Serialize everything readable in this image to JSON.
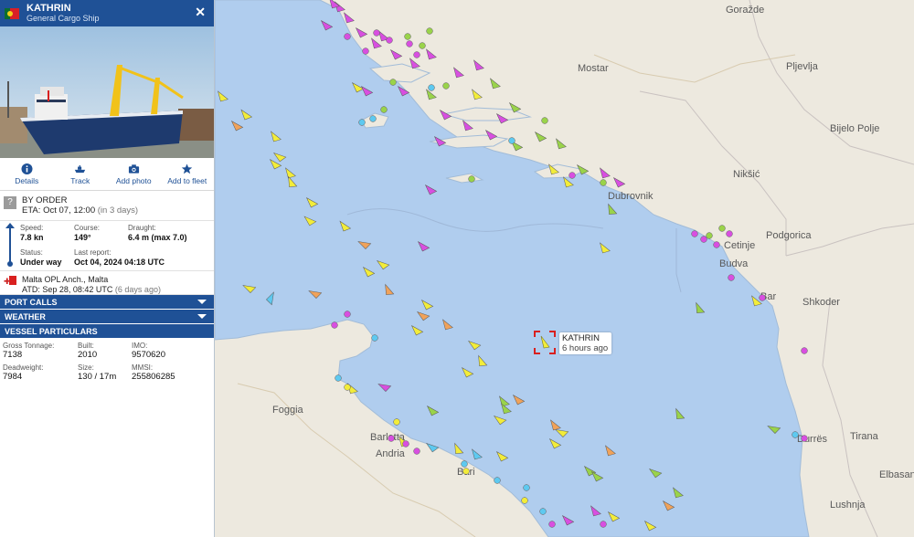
{
  "vessel": {
    "name": "KATHRIN",
    "type": "General Cargo Ship",
    "flag_colors": {
      "green": "#0a6d2f",
      "red": "#d91f26",
      "yellow": "#f4d019"
    }
  },
  "actions": [
    {
      "label": "Details",
      "icon": "info-icon"
    },
    {
      "label": "Track",
      "icon": "ship-icon"
    },
    {
      "label": "Add photo",
      "icon": "camera-icon"
    },
    {
      "label": "Add to fleet",
      "icon": "star-icon"
    }
  ],
  "destination": {
    "name": "BY ORDER",
    "eta_label": "ETA:",
    "eta": "Oct 07, 12:00",
    "eta_rel": "(in 3 days)"
  },
  "voyage": {
    "speed_label": "Speed:",
    "speed": "7.8 kn",
    "course_label": "Course:",
    "course": "149°",
    "draught_label": "Draught:",
    "draught": "6.4 m (max 7.0)",
    "status_label": "Status:",
    "status": "Under way",
    "last_report_label": "Last report:",
    "last_report": "Oct 04, 2024 04:18 UTC"
  },
  "departure": {
    "port": "Malta OPL Anch., Malta",
    "atd_label": "ATD:",
    "atd": "Sep 28, 08:42 UTC",
    "atd_rel": "(6 days ago)"
  },
  "sections": {
    "port_calls": "PORT CALLS",
    "weather": "WEATHER",
    "particulars": "VESSEL PARTICULARS"
  },
  "particulars": {
    "gross_tonnage_label": "Gross Tonnage:",
    "gross_tonnage": "7138",
    "built_label": "Built:",
    "built": "2010",
    "imo_label": "IMO:",
    "imo": "9570620",
    "deadweight_label": "Deadweight:",
    "deadweight": "7984",
    "size_label": "Size:",
    "size": "130 / 17m",
    "mmsi_label": "MMSI:",
    "mmsi": "255806285"
  },
  "map": {
    "target_name": "KATHRIN",
    "target_age": "6 hours ago",
    "cities": [
      {
        "name": "Goražde"
      },
      {
        "name": "Mostar"
      },
      {
        "name": "Pljevlja"
      },
      {
        "name": "Bijelo Polje"
      },
      {
        "name": "Nikšić"
      },
      {
        "name": "Dubrovnik"
      },
      {
        "name": "Cetinje"
      },
      {
        "name": "Podgorica"
      },
      {
        "name": "Budva"
      },
      {
        "name": "Bar"
      },
      {
        "name": "Shkoder"
      },
      {
        "name": "Foggia"
      },
      {
        "name": "Barletta"
      },
      {
        "name": "Andria"
      },
      {
        "name": "Bari"
      },
      {
        "name": "Durrës"
      },
      {
        "name": "Tirana"
      },
      {
        "name": "Elbasan"
      },
      {
        "name": "Lushnja"
      }
    ],
    "colors": {
      "sea": "#b0cdee",
      "land": "#ede9df",
      "cargo": "#9ad34a",
      "tanker": "#f2ec3a",
      "passenger": "#d84fe0",
      "tug": "#5ec9f0",
      "fishing": "#f0a25a",
      "pleasure": "#aeb0b3"
    }
  }
}
